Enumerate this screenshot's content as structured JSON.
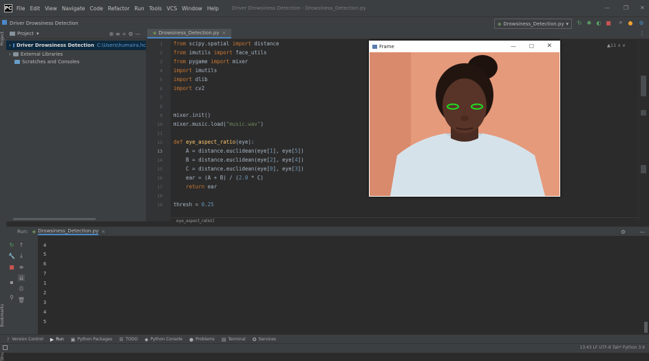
{
  "menubar": {
    "items": [
      "File",
      "Edit",
      "View",
      "Navigate",
      "Code",
      "Refactor",
      "Run",
      "Tools",
      "VCS",
      "Window",
      "Help"
    ],
    "title": "Driver Drowsiness Detection - Drowsiness_Detection.py"
  },
  "navbar": {
    "breadcrumb": "Driver Drowsiness Detection",
    "run_config": "Drowsiness_Detection.py"
  },
  "project": {
    "header": "Project",
    "root": "Driver Drowsiness Detection",
    "root_path": "C:\\Users\\humaira.hc",
    "items": [
      "External Libraries",
      "Scratches and Consoles"
    ]
  },
  "editor": {
    "tab": "Drowsiness_Detection.py",
    "line_numbers": [
      "1",
      "2",
      "3",
      "4",
      "5",
      "6",
      "7",
      "8",
      "9",
      "10",
      "11",
      "12",
      "13",
      "14",
      "15",
      "16",
      "17",
      "18",
      "19"
    ],
    "breadcrumb": "eye_aspect_ratio()",
    "inspection": "▲11"
  },
  "frame_window": {
    "title": "Frame"
  },
  "run": {
    "label": "Run:",
    "tab": "Drowsiness_Detection.py",
    "output": [
      "4",
      "5",
      "6",
      "7",
      "1",
      "2",
      "3",
      "4",
      "5"
    ]
  },
  "bottom_tools": [
    "Version Control",
    "Run",
    "Python Packages",
    "TODO",
    "Python Console",
    "Problems",
    "Terminal",
    "Services"
  ],
  "statusbar": {
    "text": "13:43  LF  UTF-8  Tab*  Python 3.9"
  },
  "side_labels": {
    "project": "Project",
    "bookmarks": "Bookmarks",
    "structure": "Structure"
  }
}
